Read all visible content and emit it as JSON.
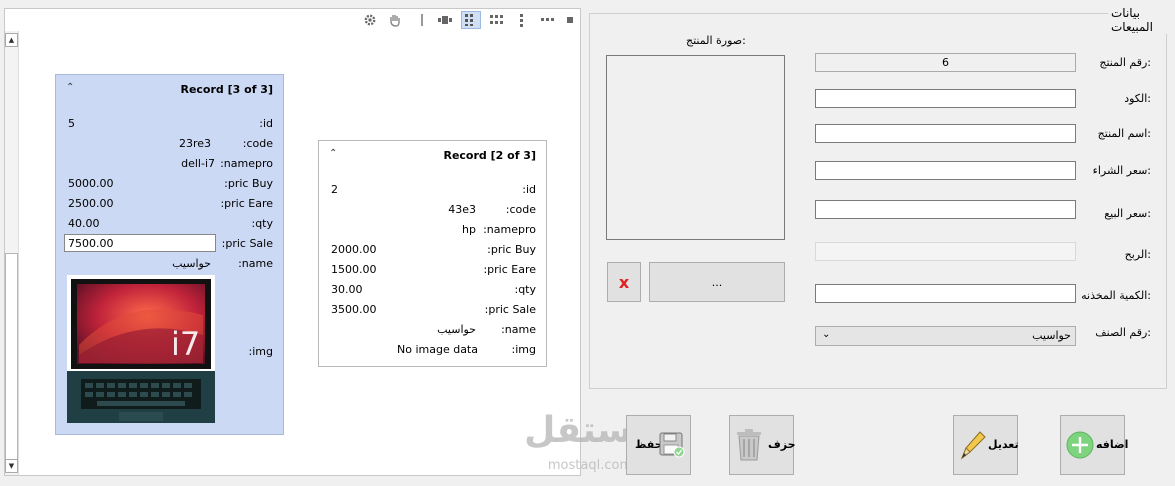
{
  "grid": {
    "toolbar": [
      "gear-icon",
      "pan-icon",
      "separator",
      "card-view-icon",
      "tile-view-icon",
      "grid-view-icon",
      "column-view-icon",
      "row-view-icon",
      "single-view-icon"
    ],
    "cards": [
      {
        "title": "Record [3 of 3]",
        "fields": [
          {
            "label": ":id",
            "value": "5"
          },
          {
            "label": ":code",
            "value": "23re3"
          },
          {
            "label": ":namepro",
            "value": "dell-i7"
          },
          {
            "label": ":pric Buy",
            "value": "5000.00"
          },
          {
            "label": ":pric Eare",
            "value": "2500.00"
          },
          {
            "label": ":qty",
            "value": "40.00"
          },
          {
            "label": ":pric Sale",
            "value": "7500.00"
          },
          {
            "label": ":name",
            "value": "حواسيب"
          },
          {
            "label": ":img",
            "value": ""
          }
        ],
        "image_text": "i7"
      },
      {
        "title": "Record [2 of 3]",
        "fields": [
          {
            "label": ":id",
            "value": "2"
          },
          {
            "label": ":code",
            "value": "43e3"
          },
          {
            "label": ":namepro",
            "value": "hp"
          },
          {
            "label": ":pric Buy",
            "value": "2000.00"
          },
          {
            "label": ":pric Eare",
            "value": "1500.00"
          },
          {
            "label": ":qty",
            "value": "30.00"
          },
          {
            "label": ":pric Sale",
            "value": "3500.00"
          },
          {
            "label": ":name",
            "value": "حواسيب"
          },
          {
            "label": ":img",
            "value": "No image data"
          }
        ]
      }
    ]
  },
  "form": {
    "group_title": "بيانات المبيعات",
    "image_label": "صورة المنتج:",
    "fields": [
      {
        "label": "رقم المنتج:",
        "value": "6"
      },
      {
        "label": "الكود:",
        "value": ""
      },
      {
        "label": "اسم المنتج:",
        "value": ""
      },
      {
        "label": "سعر الشراء:",
        "value": ""
      },
      {
        "label": "سعر البيع:",
        "value": ""
      },
      {
        "label": "الربح:",
        "value": ""
      },
      {
        "label": "الكمية المخذنه:",
        "value": ""
      }
    ],
    "category_label": "رقم الصنف:",
    "category_value": "حواسيب",
    "browse_label": "...",
    "clear_label": "x"
  },
  "actions": {
    "save": "حفظ",
    "delete": "حزف",
    "edit": "تعديل",
    "add": "اضافه"
  },
  "watermark": {
    "brand": "مستقل",
    "url": "mostaql.com"
  },
  "colors": {
    "card_selected": "#ccd9f4",
    "clear_x": "#e02020",
    "add_green": "#7ed37e"
  }
}
